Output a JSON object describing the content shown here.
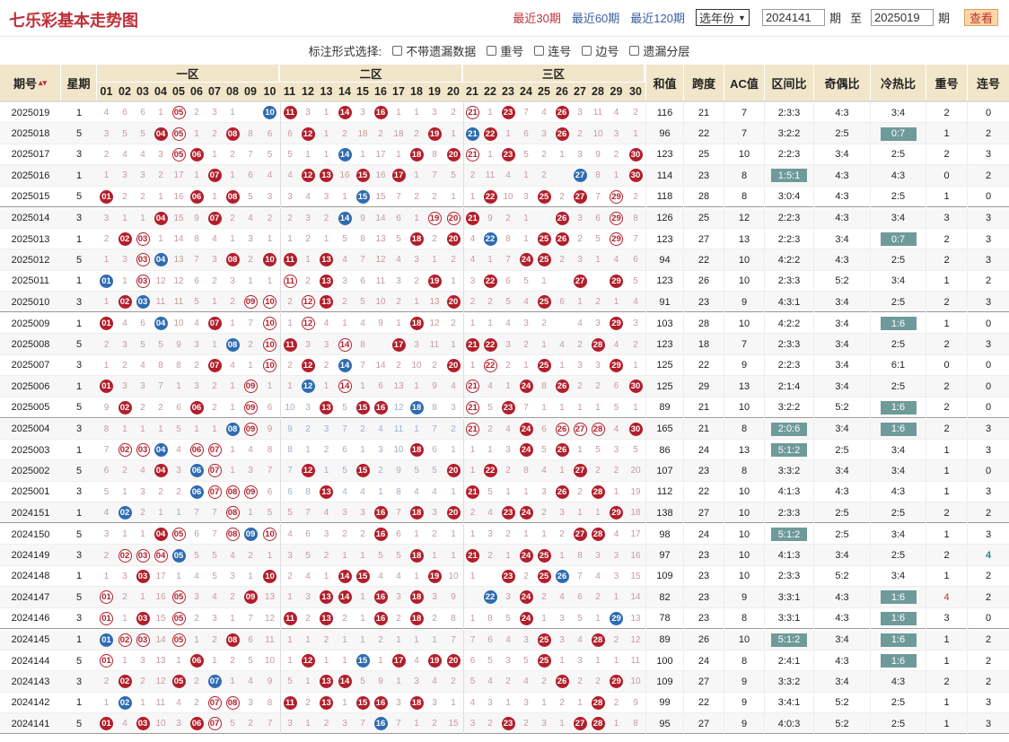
{
  "page_title": "七乐彩基本走势图",
  "top_links": [
    "最近30期",
    "最近60期",
    "最近120期"
  ],
  "year_select": "选年份",
  "from_period": "2024141",
  "to_period": "2025019",
  "period_word": "期",
  "to_word": "至",
  "query_label": "查看",
  "option_bar_label": "标注形式选择:",
  "options": [
    "不带遗漏数据",
    "重号",
    "连号",
    "边号",
    "遗漏分层"
  ],
  "headers": {
    "period": "期号",
    "weekday": "星期",
    "zones": [
      "一区",
      "二区",
      "三区"
    ],
    "numbers": [
      "01",
      "02",
      "03",
      "04",
      "05",
      "06",
      "07",
      "08",
      "09",
      "10",
      "11",
      "12",
      "13",
      "14",
      "15",
      "16",
      "17",
      "18",
      "19",
      "20",
      "21",
      "22",
      "23",
      "24",
      "25",
      "26",
      "27",
      "28",
      "29",
      "30"
    ],
    "stats": [
      "和值",
      "跨度",
      "AC值",
      "区间比",
      "奇偶比",
      "冷热比",
      "重号",
      "连号"
    ]
  },
  "colors": {
    "red_ball": "#b21e2a",
    "blue_ball": "#2e6bb2",
    "header_bg": "#f1e6c9",
    "ratio_box": "#6f9a9a",
    "title": "#c0303a"
  },
  "legend_codes": {
    "r": "red ball",
    "b": "blue ball",
    "o": "outlined red ball"
  },
  "rows": [
    {
      "period": "2025019",
      "weekday": "1",
      "balls": "5o 10b 11r 14r 16r 21o 23r 26r",
      "miss": "4 6 6 1 . 2 3 1 . . . 3 1 . 3 . 1 1 3 2 . 1 . 7 4 . 3 11 4 2",
      "stats": [
        "116",
        "21",
        "7",
        "2:3:3",
        "4:3",
        "3:4",
        "2",
        "0"
      ]
    },
    {
      "period": "2025018",
      "weekday": "5",
      "balls": "4r 5o 8r 12r 19r 21b 22r 26r",
      "miss": "3 5 5 . . 1 2 . 8 6 6 . 1 2 18 2 18 2 . 1 . . 1 6 3 . 2 10 3 1",
      "stats": [
        "96",
        "22",
        "7",
        "3:2:2",
        "2:5",
        "0:7",
        "1",
        "2"
      ]
    },
    {
      "period": "2025017",
      "weekday": "3",
      "balls": "5o 6r 14b 18r 20r 21o 23r 30r",
      "miss": "2 4 4 3 . . 1 2 7 5 5 1 1 . 1 17 1 . 8 . . 1 . 5 2 1 3 9 2 .",
      "stats": [
        "123",
        "25",
        "10",
        "2:2:3",
        "3:4",
        "2:5",
        "2",
        "3"
      ]
    },
    {
      "period": "2025016",
      "weekday": "1",
      "balls": "7r 12r 13r 15r 17r 27b 30r",
      "miss": "1 3 3 2 17 1 . 1 6 4 4 . . 16 . 16 . 1 7 5 2 11 4 1 2 . . 8 1 .",
      "stats": [
        "114",
        "23",
        "8",
        "1:5:1",
        "4:3",
        "4:3",
        "0",
        "2"
      ]
    },
    {
      "period": "2025015",
      "weekday": "5",
      "balls": "1r 6r 8r 15b 22r 25r 27r 29o",
      "miss": ". 2 2 1 16 . 1 . 5 3 3 4 3 1 . 15 7 2 2 1 1 . 10 3 . 2 . 7 . 2",
      "stats": [
        "118",
        "28",
        "8",
        "3:0:4",
        "4:3",
        "2:5",
        "1",
        "0"
      ]
    },
    {
      "period": "2025014",
      "weekday": "3",
      "balls": "4r 7r 14b 19o 20o 21r 26r 29o",
      "miss": "3 1 1 . 15 9 . 2 4 2 2 3 2 . 9 14 6 1 . . . 9 2 1 . . 3 6 . 8",
      "stats": [
        "126",
        "25",
        "12",
        "2:2:3",
        "4:3",
        "3:4",
        "3",
        "3"
      ]
    },
    {
      "period": "2025013",
      "weekday": "1",
      "balls": "2r 3o 18r 20r 22b 25r 26r 29o",
      "miss": "2 . . 1 14 8 4 1 3 1 1 2 1 5 8 13 5 . 2 . 4 . 8 1 . . 2 5 . 7",
      "stats": [
        "123",
        "27",
        "13",
        "2:2:3",
        "3:4",
        "0:7",
        "2",
        "3"
      ]
    },
    {
      "period": "2025012",
      "weekday": "5",
      "balls": "3o 4b 8r 10r 11r 13r 24r 25r",
      "miss": "1 3 . . 13 7 3 . 2 . . 1 . 4 7 12 4 3 1 2 4 1 7 . . 2 3 1 4 6",
      "stats": [
        "94",
        "22",
        "10",
        "4:2:2",
        "4:3",
        "2:5",
        "2",
        "3"
      ]
    },
    {
      "period": "2025011",
      "weekday": "1",
      "balls": "1b 3o 11o 13r 19r 22r 27r 29r",
      "miss": ". 1 . 12 12 6 2 3 1 1 . 2 . 3 6 11 3 2 . 1 3 . 6 5 1 . 2 . 3 5",
      "stats": [
        "123",
        "26",
        "10",
        "2:3:3",
        "5:2",
        "3:4",
        "1",
        "2"
      ]
    },
    {
      "period": "2025010",
      "weekday": "3",
      "balls": "2r 3b 9o 10o 12o 13r 20r 25r",
      "miss": "1 . . 11 11 5 1 2 . . 2 . . 2 5 10 2 1 13 . 2 2 5 4 . 6 1 2 1 4",
      "stats": [
        "91",
        "23",
        "9",
        "4:3:1",
        "3:4",
        "2:5",
        "2",
        "3"
      ]
    },
    {
      "period": "2025009",
      "weekday": "1",
      "balls": "1r 4b 7r 10o 12o 18r 29r",
      "miss": ". 4 6 . 10 4 . 1 7 . 1 . 4 1 4 9 1 . 12 2 1 1 4 3 2 . 4 3 . 3",
      "stats": [
        "103",
        "28",
        "10",
        "4:2:2",
        "3:4",
        "1:6",
        "1",
        "0"
      ]
    },
    {
      "period": "2025008",
      "weekday": "5",
      "balls": "8b 10o 11r 14o 17r 21r 22r 28r",
      "miss": "2 3 5 5 9 3 1 . 2 . . 3 3 . 8 . 7 3 11 1 . . 3 2 1 4 2 . 4 2",
      "stats": [
        "123",
        "18",
        "7",
        "2:3:3",
        "3:4",
        "2:5",
        "2",
        "3"
      ]
    },
    {
      "period": "2025007",
      "weekday": "3",
      "balls": "7r 10o 12r 14b 20r 22o 25r 29r",
      "miss": "1 2 4 8 8 2 . 4 1 . 2 . 2 . 7 14 2 10 2 . 1 . 2 1 . 1 3 3 . 1",
      "stats": [
        "125",
        "22",
        "9",
        "2:2:3",
        "3:4",
        "6:1",
        "0",
        "0"
      ]
    },
    {
      "period": "2025006",
      "weekday": "1",
      "balls": "1r 9o 12b 14o 21o 24r 26r 30r",
      "miss": ". 3 3 7 1 3 2 1 . 1 1 . 1 . 1 6 13 1 9 4 . 4 1 . 8 . 2 2 6 .",
      "stats": [
        "125",
        "29",
        "13",
        "2:1:4",
        "3:4",
        "2:5",
        "2",
        "0"
      ]
    },
    {
      "period": "2025005",
      "weekday": "5",
      "balls": "2r 6r 9o 13r 15r 16r 18b 21o 23r",
      "miss": "9 . 2 2 6 . 2 1 . 6 10 3 . 5 . . 12 . 8 3 . 5 . 7 1 1 1 1 5 1",
      "stats": [
        "89",
        "21",
        "10",
        "3:2:2",
        "5:2",
        "1:6",
        "2",
        "0"
      ]
    },
    {
      "period": "2025004",
      "weekday": "3",
      "balls": "8b 9o 21o 24r 26o 27o 28o 30r",
      "miss": "8 1 1 1 5 1 1 . . 9 9 2 3 7 2 4 11 1 7 2 . 2 4 . 6 . . . 4 .",
      "stats": [
        "165",
        "21",
        "8",
        "2:0:6",
        "3:4",
        "1:6",
        "2",
        "3"
      ]
    },
    {
      "period": "2025003",
      "weekday": "1",
      "balls": "2o 3o 4b 6o 7o 18r 24r 26r",
      "miss": "7 . . . 4 . . 1 4 8 8 1 2 6 1 3 10 . 6 1 1 1 3 . 5 . 1 5 3 5",
      "stats": [
        "86",
        "24",
        "13",
        "5:1:2",
        "2:5",
        "3:4",
        "1",
        "3"
      ]
    },
    {
      "period": "2025002",
      "weekday": "5",
      "balls": "4r 6b 7o 12r 15r 20r 22r 27r",
      "miss": "6 2 4 . 3 . . 1 3 7 7 . 1 5 . 2 9 5 5 . 1 . 2 8 4 1 . 2 2 20",
      "stats": [
        "107",
        "23",
        "8",
        "3:3:2",
        "3:4",
        "3:4",
        "1",
        "0"
      ]
    },
    {
      "period": "2025001",
      "weekday": "3",
      "balls": "6b 7o 8o 9o 13r 21r 26r 28r",
      "miss": "5 1 3 2 2 . . . . 6 6 8 . 4 4 1 8 4 4 1 . 5 1 1 3 . 2 . 1 19",
      "stats": [
        "112",
        "22",
        "10",
        "4:1:3",
        "4:3",
        "4:3",
        "1",
        "3"
      ]
    },
    {
      "period": "2024151",
      "weekday": "1",
      "balls": "2b 8o 16r 18r 20r 23r 24r 29r",
      "miss": "4 . 2 1 1 7 7 . 1 5 5 7 4 3 3 . 7 . 3 . 2 4 . . 2 3 1 1 . 18",
      "stats": [
        "138",
        "27",
        "10",
        "2:3:3",
        "2:5",
        "2:5",
        "2",
        "2"
      ]
    },
    {
      "period": "2024150",
      "weekday": "5",
      "balls": "4r 5o 8o 9b 10o 16r 27r 28r",
      "miss": "3 1 1 . . 6 7 . . . 4 6 3 2 2 . 6 1 2 1 1 3 2 1 1 2 . . 4 17",
      "stats": [
        "98",
        "24",
        "10",
        "5:1:2",
        "2:5",
        "3:4",
        "1",
        "3"
      ]
    },
    {
      "period": "2024149",
      "weekday": "3",
      "balls": "2o 3o 4o 5b 18r 21r 24r 25r",
      "miss": "2 . . . . 5 5 4 2 1 3 5 2 1 1 5 5 . 1 1 . 2 1 . . 1 8 3 3 16",
      "stats": [
        "97",
        "23",
        "10",
        "4:1:3",
        "3:4",
        "2:5",
        "2",
        "4"
      ]
    },
    {
      "period": "2024148",
      "weekday": "1",
      "balls": "3r 10r 14r 15r 19r 23r 25r 26b",
      "miss": "1 3 . 17 1 4 5 3 1 . 2 4 1 . . 4 4 1 . 10 1 . . 2 . . 7 4 3 15",
      "stats": [
        "109",
        "23",
        "10",
        "2:3:3",
        "5:2",
        "3:4",
        "1",
        "2"
      ]
    },
    {
      "period": "2024147",
      "weekday": "5",
      "balls": "1o 5o 9r 13r 14r 16r 18r 22b 24r",
      "miss": ". 2 1 16 . 3 4 2 . 13 1 3 . . 1 . 3 . 3 9 . . 3 . 2 4 6 2 1 14",
      "stats": [
        "82",
        "23",
        "9",
        "3:3:1",
        "4:3",
        "1:6",
        "4",
        "2"
      ]
    },
    {
      "period": "2024146",
      "weekday": "3",
      "balls": "1o 3r 5o 11r 13r 16r 18r 24r 29b",
      "miss": ". 1 . 15 . 2 3 1 7 12 . 2 . 2 1 . 2 . 2 8 1 8 5 . 1 3 5 1 . 13",
      "stats": [
        "78",
        "23",
        "8",
        "3:3:1",
        "4:3",
        "1:6",
        "3",
        "0"
      ]
    },
    {
      "period": "2024145",
      "weekday": "1",
      "balls": "1b 2o 3o 5o 8r 25r 28r",
      "miss": ". . . 14 . 1 2 . 6 11 1 1 2 1 1 2 1 1 1 7 7 6 4 3 . 3 4 . 2 12",
      "stats": [
        "89",
        "26",
        "10",
        "5:1:2",
        "3:4",
        "1:6",
        "1",
        "2"
      ]
    },
    {
      "period": "2024144",
      "weekday": "5",
      "balls": "1o 6r 12r 15b 17r 19r 20r 25r",
      "miss": ". 1 3 13 1 . 1 2 5 10 1 . 1 1 . 1 . 4 . . 6 5 3 5 . 1 3 1 1 11",
      "stats": [
        "100",
        "24",
        "8",
        "2:4:1",
        "4:3",
        "1:6",
        "1",
        "2"
      ]
    },
    {
      "period": "2024143",
      "weekday": "3",
      "balls": "2r 5r 7b 13r 14r 26r 29r",
      "miss": "2 . 2 12 . 2 . 1 4 9 5 1 . . 5 9 1 3 4 2 5 4 2 4 2 . 2 2 . 10",
      "stats": [
        "109",
        "27",
        "9",
        "3:3:2",
        "3:4",
        "4:3",
        "2",
        "2"
      ]
    },
    {
      "period": "2024142",
      "weekday": "1",
      "balls": "2b 7o 8o 11r 13r 15r 16r 18r 28r",
      "miss": "1 . 1 11 4 2 . . 3 8 . 2 . 1 . . 3 . 3 1 4 3 1 3 1 2 1 . 2 9",
      "stats": [
        "99",
        "22",
        "9",
        "3:4:1",
        "5:2",
        "2:5",
        "1",
        "3"
      ]
    },
    {
      "period": "2024141",
      "weekday": "5",
      "balls": "1r 3r 6r 7o 16b 23r 27r 28r",
      "miss": ". 4 . 10 3 . . 5 2 7 3 1 2 3 7 . 7 1 2 15 3 2 . 2 3 1 . . 1 8",
      "stats": [
        "95",
        "27",
        "9",
        "4:0:3",
        "5:2",
        "2:5",
        "1",
        "3"
      ]
    }
  ]
}
